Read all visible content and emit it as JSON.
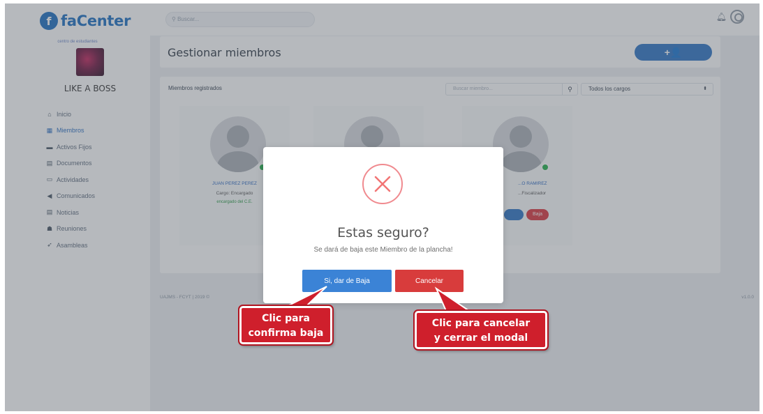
{
  "app": {
    "logo_letter": "f",
    "logo_text": "faCenter"
  },
  "sidebar": {
    "center_label": "centro de estudiantes",
    "center_name": "LIKE A BOSS",
    "items": [
      {
        "icon": "home-icon",
        "glyph": "⌂",
        "label": "Inicio"
      },
      {
        "icon": "members-icon",
        "glyph": "▦",
        "label": "Miembros"
      },
      {
        "icon": "assets-icon",
        "glyph": "▬",
        "label": "Activos Fijos"
      },
      {
        "icon": "documents-icon",
        "glyph": "▤",
        "label": "Documentos"
      },
      {
        "icon": "activities-icon",
        "glyph": "▭",
        "label": "Actividades"
      },
      {
        "icon": "announcements-icon",
        "glyph": "◀",
        "label": "Comunicados"
      },
      {
        "icon": "news-icon",
        "glyph": "▤",
        "label": "Noticias"
      },
      {
        "icon": "meetings-icon",
        "glyph": "☗",
        "label": "Reuniones"
      },
      {
        "icon": "assemblies-icon",
        "glyph": "➶",
        "label": "Asambleas"
      }
    ]
  },
  "topbar": {
    "search_placeholder": "Buscar..."
  },
  "header": {
    "title": "Gestionar miembros",
    "add_button": "+👤"
  },
  "members": {
    "title": "Miembros registrados",
    "search_placeholder": "Buscar miembro...",
    "role_filter": "Todos los cargos",
    "cards": [
      {
        "name": "JUAN PEREZ PEREZ",
        "role": "Cargo: Encargado",
        "note": "encargado del C.E."
      },
      {
        "name": "",
        "role": "",
        "note": ""
      },
      {
        "name": "...O RAMIREZ",
        "role": "...Fiscalizador",
        "note": ""
      }
    ],
    "baja_label": "Baja"
  },
  "footer": {
    "left": "UAJMS - FCYT | 2019 ©",
    "right": "v1.0.0"
  },
  "modal": {
    "title": "Estas seguro?",
    "text": "Se dará de baja este Miembro de la plancha!",
    "confirm": "Si, dar de Baja",
    "cancel": "Cancelar"
  },
  "annotations": {
    "confirm_line1": "Clic para",
    "confirm_line2": "confirma baja",
    "cancel_line1": "Clic para cancelar",
    "cancel_line2": "y cerrar el modal"
  }
}
